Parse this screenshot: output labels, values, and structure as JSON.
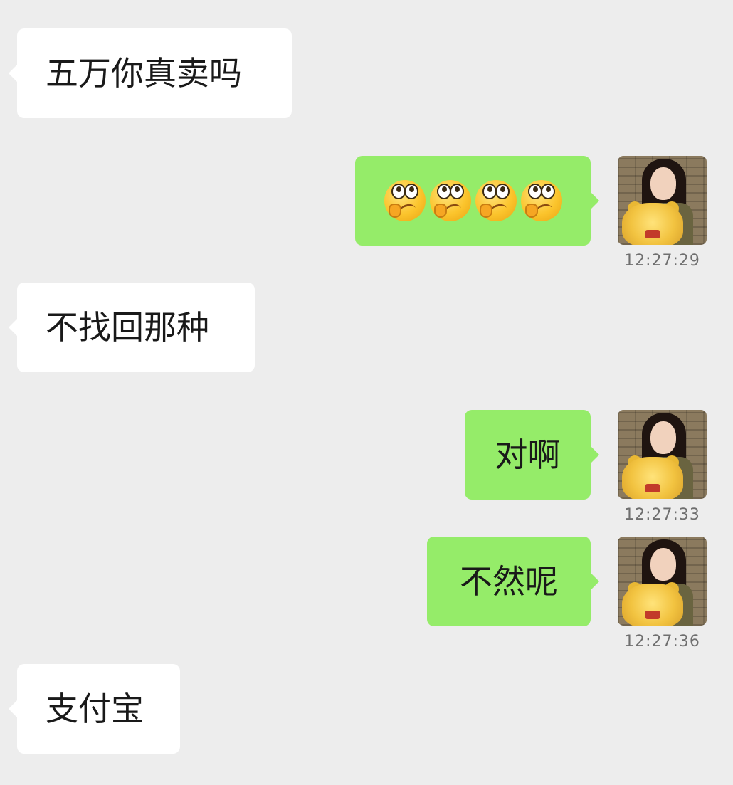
{
  "messages": [
    {
      "side": "left",
      "text": "五万你真卖吗"
    },
    {
      "side": "right",
      "content": "emoji",
      "emoji": [
        "thinking-eyes-emoji",
        "thinking-eyes-emoji",
        "thinking-eyes-emoji",
        "thinking-eyes-emoji"
      ],
      "time": "12:27:29"
    },
    {
      "side": "left",
      "text": "不找回那种"
    },
    {
      "side": "right",
      "text": "对啊",
      "time": "12:27:33"
    },
    {
      "side": "right",
      "text": "不然呢",
      "time": "12:27:36"
    },
    {
      "side": "left",
      "text": "支付宝"
    }
  ],
  "colors": {
    "background": "#ededed",
    "incoming_bubble": "#ffffff",
    "outgoing_bubble": "#95ec69",
    "timestamp": "#6f6f6f"
  }
}
